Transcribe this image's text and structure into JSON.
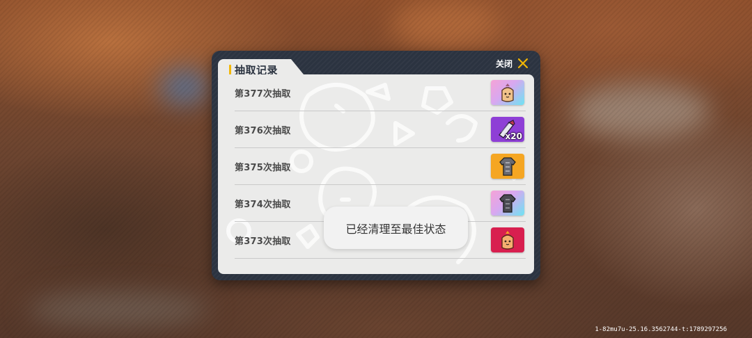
{
  "dialog": {
    "title": "抽取记录",
    "close_label": "关闭",
    "close_icon": "close-x-icon",
    "accent_color": "#f2b705"
  },
  "records": [
    {
      "label": "第377次抽取",
      "item_icon": "character-bust-icon",
      "rarity_color": "pink-cyan-gradient",
      "quantity": ""
    },
    {
      "label": "第376次抽取",
      "item_icon": "scroll-ticket-icon",
      "rarity_color": "#8e3fd6",
      "quantity": "x20"
    },
    {
      "label": "第375次抽取",
      "item_icon": "armor-outfit-icon",
      "rarity_color": "#f5a623",
      "quantity": ""
    },
    {
      "label": "第374次抽取",
      "item_icon": "armor-outfit-icon",
      "rarity_color": "pink-cyan-gradient",
      "quantity": ""
    },
    {
      "label": "第373次抽取",
      "item_icon": "character-bust-icon",
      "rarity_color": "#d81f4f",
      "quantity": ""
    }
  ],
  "toast": {
    "message": "已经清理至最佳状态"
  },
  "footer": {
    "build_id": "1-82mu7u-25.16.3562744-t:1789297256"
  }
}
